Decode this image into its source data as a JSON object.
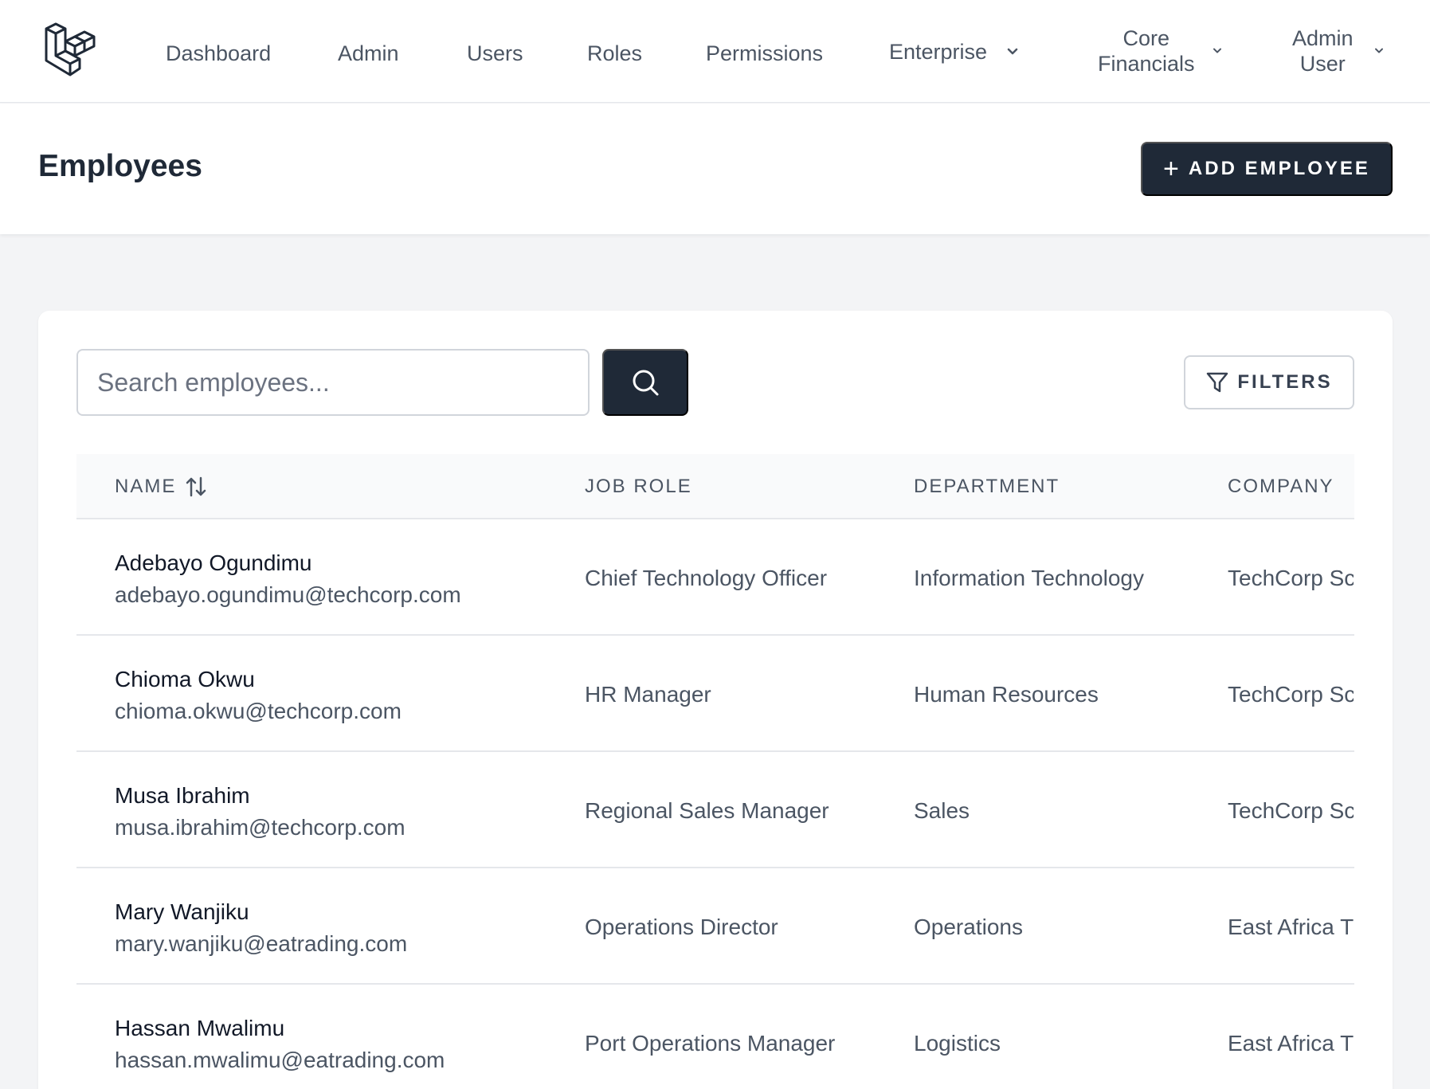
{
  "nav": {
    "links": [
      "Dashboard",
      "Admin",
      "Users",
      "Roles",
      "Permissions"
    ],
    "enterprise": "Enterprise",
    "core_financials": [
      "Core",
      "Financials"
    ],
    "user": [
      "Admin",
      "User"
    ]
  },
  "page": {
    "title": "Employees",
    "add_button": "ADD EMPLOYEE",
    "add_icon": "+"
  },
  "search": {
    "placeholder": "Search employees...",
    "filters_label": "FILTERS"
  },
  "table": {
    "headers": {
      "name": "NAME",
      "job_role": "JOB ROLE",
      "department": "DEPARTMENT",
      "company": "COMPANY"
    },
    "rows": [
      {
        "name": "Adebayo Ogundimu",
        "email": "adebayo.ogundimu@techcorp.com",
        "job_role": "Chief Technology Officer",
        "department": "Information Technology",
        "company": "TechCorp Sc"
      },
      {
        "name": "Chioma Okwu",
        "email": "chioma.okwu@techcorp.com",
        "job_role": "HR Manager",
        "department": "Human Resources",
        "company": "TechCorp Sc"
      },
      {
        "name": "Musa Ibrahim",
        "email": "musa.ibrahim@techcorp.com",
        "job_role": "Regional Sales Manager",
        "department": "Sales",
        "company": "TechCorp Sc"
      },
      {
        "name": "Mary Wanjiku",
        "email": "mary.wanjiku@eatrading.com",
        "job_role": "Operations Director",
        "department": "Operations",
        "company": "East Africa T"
      },
      {
        "name": "Hassan Mwalimu",
        "email": "hassan.mwalimu@eatrading.com",
        "job_role": "Port Operations Manager",
        "department": "Logistics",
        "company": "East Africa T"
      }
    ]
  },
  "colors": {
    "primary_dark": "#1f2937",
    "border": "#e5e7eb",
    "background": "#f3f4f6",
    "text_muted": "#4b5563"
  },
  "icons": {
    "logo": "laravel-logo-icon",
    "search": "search-icon",
    "filter": "filter-icon",
    "sort": "sort-arrows-icon",
    "chevron": "chevron-down-icon"
  }
}
